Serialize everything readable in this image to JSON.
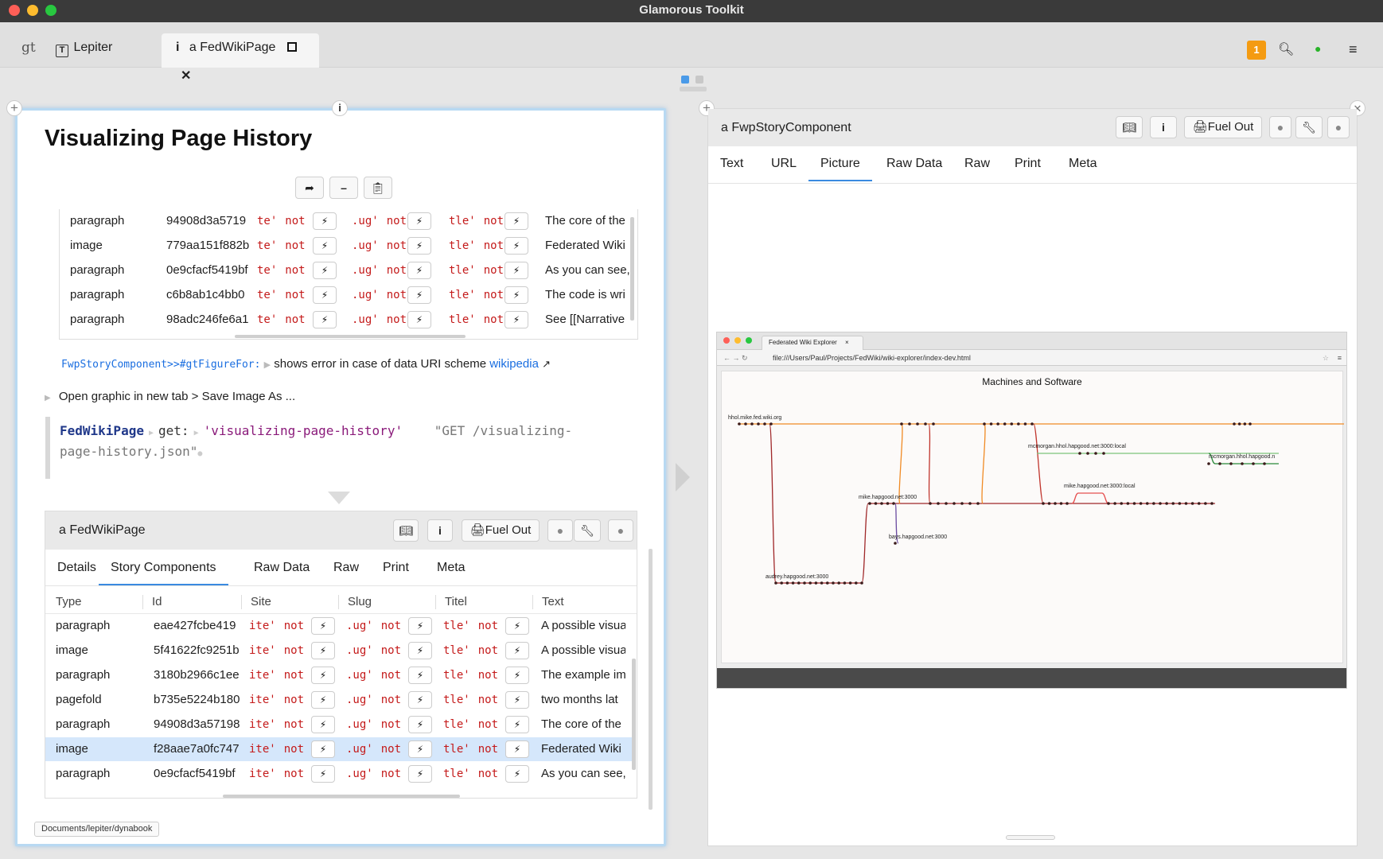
{
  "window": {
    "title": "Glamorous Toolkit"
  },
  "tabs": {
    "gt_label": "gt",
    "lepiter_label": "Lepiter",
    "active_icon": "i",
    "active_label": "a FedWikiPage",
    "notification_count": "1"
  },
  "left": {
    "page_title": "Visualizing Page History",
    "top_rows": [
      {
        "type": "paragraph",
        "id": "94908d3a5719",
        "text": "The core of the"
      },
      {
        "type": "image",
        "id": "779aa151f882b",
        "text": "Federated Wiki"
      },
      {
        "type": "paragraph",
        "id": "0e9cfacf5419bf",
        "text": "As you can see,"
      },
      {
        "type": "paragraph",
        "id": "c6b8ab1c4bb0",
        "text": "The code is wri"
      },
      {
        "type": "paragraph",
        "id": "98adc246fe6a1",
        "text": "See [[Narrative"
      }
    ],
    "site_frag": "te'",
    "slug_frag": ".ug'",
    "titel_frag": "tle'",
    "not_word": "not",
    "method_ref": "FwpStoryComponent>>#gtFigureFor:",
    "method_note": "shows error in case of data URI scheme",
    "wiki_link": "wikipedia",
    "open_graphic": "Open graphic in new tab > Save Image As ...",
    "code_receiver": "FedWikiPage",
    "code_selector": "get:",
    "code_arg": "'visualizing-page-history'",
    "code_comment_1": "\"GET /visualizing-",
    "code_comment_2": "page-history.json\"",
    "inspector": {
      "title": "a FedWikiPage",
      "fuel_out": "Fuel Out",
      "tabs": [
        "Details",
        "Story Components",
        "Raw Data",
        "Raw",
        "Print",
        "Meta"
      ],
      "headers": [
        "Type",
        "Id",
        "Site",
        "Slug",
        "Titel",
        "Text"
      ],
      "rows": [
        {
          "type": "paragraph",
          "id": "eae427fcbe419",
          "text": "A possible visua"
        },
        {
          "type": "image",
          "id": "5f41622fc9251b",
          "text": "A possible visua"
        },
        {
          "type": "paragraph",
          "id": "3180b2966c1ee",
          "text": "The example im"
        },
        {
          "type": "pagefold",
          "id": "b735e5224b180",
          "text": "two months lat"
        },
        {
          "type": "paragraph",
          "id": "94908d3a57198",
          "text": "The core of the"
        },
        {
          "type": "image",
          "id": "f28aae7a0fc747",
          "text": "Federated Wiki"
        },
        {
          "type": "paragraph",
          "id": "0e9cfacf5419bf",
          "text": "As you can see,"
        }
      ],
      "site_frag": "ite'",
      "slug_frag": ".ug'",
      "titel_frag": "tle'"
    },
    "path_badge": "Documents/lepiter/dynabook"
  },
  "right": {
    "title": "a FwpStoryComponent",
    "fuel_out": "Fuel Out",
    "tabs": [
      "Text",
      "URL",
      "Picture",
      "Raw Data",
      "Raw",
      "Print",
      "Meta"
    ],
    "active_tab": "Picture",
    "picture": {
      "browser_tab": "Federated Wiki Explorer",
      "url": "file:///Users/Paul/Projects/FedWiki/wiki-explorer/index-dev.html",
      "chart_title": "Machines and Software",
      "labels": {
        "hhol": "hhol.mike.fed.wiki.org",
        "mcmorgan": "mcmorgan.hhol.hapgood.net:3000:local",
        "mcmorgan2": "mcmorgan.hhol.hapgood.n",
        "mike_local": "mike.hapgood.net:3000:local",
        "mike": "mike.hapgood.net:3000",
        "bays": "bays.hapgood.net:3000",
        "audrey": "audrey.hapgood.net:3000"
      }
    }
  },
  "colors": {
    "accent": "#3a8ae0",
    "string_red": "#c41a1a",
    "badge": "#f49b12",
    "orange_line": "#f08a24",
    "green_line": "#7cc47c",
    "dark_red_line": "#a0282a"
  }
}
